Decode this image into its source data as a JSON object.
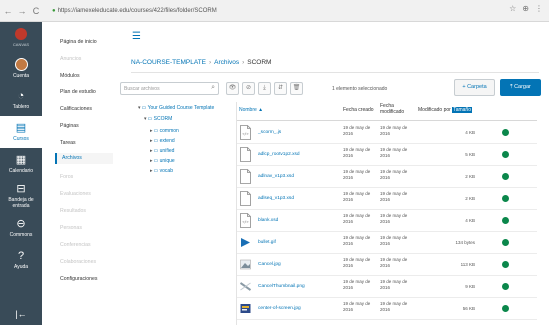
{
  "browser": {
    "nav": [
      "←",
      "→",
      "C"
    ],
    "url": "https://iamexeleducate.edu/courses/422/files/folder/SCORM",
    "icons": [
      "☆",
      "⊕",
      "⋮"
    ]
  },
  "global_nav": {
    "logo_text": "CANVAS",
    "items": [
      {
        "id": "account",
        "label": "Cuenta",
        "icon": "avatar"
      },
      {
        "id": "dashboard",
        "label": "Tablero",
        "icon": "◔"
      },
      {
        "id": "courses",
        "label": "Cursos",
        "icon": "▤",
        "active": true
      },
      {
        "id": "calendar",
        "label": "Calendario",
        "icon": "▦"
      },
      {
        "id": "inbox",
        "label": "Bandeja de entrada",
        "icon": "⊟"
      },
      {
        "id": "commons",
        "label": "Commons",
        "icon": "⊖"
      },
      {
        "id": "help",
        "label": "Ayuda",
        "icon": "?"
      }
    ],
    "collapse": "|←"
  },
  "course_nav": [
    {
      "label": "Página de inicio",
      "state": "normal"
    },
    {
      "label": "Anuncios",
      "state": "disabled"
    },
    {
      "label": "Módulos",
      "state": "normal"
    },
    {
      "label": "Plan de estudio",
      "state": "normal"
    },
    {
      "label": "Calificaciones",
      "state": "normal"
    },
    {
      "label": "Páginas",
      "state": "normal"
    },
    {
      "label": "Tareas",
      "state": "normal"
    },
    {
      "label": "Archivos",
      "state": "active"
    },
    {
      "label": "Foros",
      "state": "disabled"
    },
    {
      "label": "Evaluaciones",
      "state": "disabled"
    },
    {
      "label": "Resultados",
      "state": "disabled"
    },
    {
      "label": "Personas",
      "state": "disabled"
    },
    {
      "label": "Conferencias",
      "state": "disabled"
    },
    {
      "label": "Colaboraciones",
      "state": "disabled"
    },
    {
      "label": "Configuraciones",
      "state": "normal"
    }
  ],
  "breadcrumb": {
    "course": "NA-COURSE-TEMPLATE",
    "files": "Archivos",
    "current": "SCORM"
  },
  "toolbar": {
    "search_placeholder": "Buscar archivos",
    "tools": [
      "👁",
      "⊘",
      "⤓",
      "⇵",
      "🗑"
    ],
    "selected_count": "1 elemento seleccionado",
    "new_folder": "+ Carpeta",
    "upload": "⤒ Cargar"
  },
  "tree": [
    {
      "label": "Your Guided Course Template",
      "toggle": "▾",
      "level": 0
    },
    {
      "label": "SCORM",
      "toggle": "▾",
      "level": 1
    },
    {
      "label": "common",
      "toggle": "▸",
      "level": 2
    },
    {
      "label": "extend",
      "toggle": "▸",
      "level": 2
    },
    {
      "label": "unified",
      "toggle": "▸",
      "level": 2
    },
    {
      "label": "unique",
      "toggle": "▸",
      "level": 2
    },
    {
      "label": "vocab",
      "toggle": "▸",
      "level": 2
    }
  ],
  "columns": {
    "name": "Nombre",
    "created": "Fecha creado",
    "modified_1": "Fecha",
    "modified_2": "modificado",
    "modified_by": "Modificado por",
    "size": "Tamaño"
  },
  "files": [
    {
      "name": "_scorm_.js",
      "created": "19 de may de 2016",
      "modified": "19 de may de 2016",
      "size": "4 KB",
      "type": "js"
    },
    {
      "name": "adlcp_rootv1p2.xsd",
      "created": "19 de may de 2016",
      "modified": "19 de may de 2016",
      "size": "5 KB",
      "type": "doc"
    },
    {
      "name": "adlnav_v1p3.xsd",
      "created": "19 de may de 2016",
      "modified": "19 de may de 2016",
      "size": "2 KB",
      "type": "doc"
    },
    {
      "name": "adlseq_v1p3.xsd",
      "created": "19 de may de 2016",
      "modified": "19 de may de 2016",
      "size": "2 KB",
      "type": "doc"
    },
    {
      "name": "blank.xsd",
      "created": "19 de may de 2016",
      "modified": "19 de may de 2016",
      "size": "4 KB",
      "type": "code"
    },
    {
      "name": "bullet.gif",
      "created": "19 de may de 2016",
      "modified": "19 de may de 2016",
      "size": "134 bytes",
      "type": "gif"
    },
    {
      "name": "Cancel.jpg",
      "created": "19 de may de 2016",
      "modified": "19 de may de 2016",
      "size": "113 KB",
      "type": "img"
    },
    {
      "name": "CancelThumbnail.png",
      "created": "19 de may de 2016",
      "modified": "19 de may de 2016",
      "size": "9 KB",
      "type": "img2"
    },
    {
      "name": "center-of-screen.jpg",
      "created": "19 de may de 2016",
      "modified": "19 de may de 2016",
      "size": "56 KB",
      "type": "img3"
    }
  ],
  "colors": {
    "accent": "#0374b5",
    "nav_bg": "#394b58",
    "published": "#0b874b"
  }
}
